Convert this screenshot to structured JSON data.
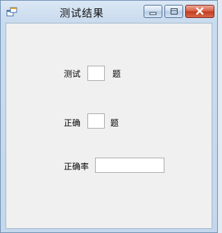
{
  "window": {
    "title": "测试结果",
    "icon": "app-window-icon",
    "controls": {
      "minimize_icon": "minimize-icon",
      "maximize_icon": "maximize-icon",
      "close_icon": "close-icon"
    }
  },
  "form": {
    "test_label": "测试",
    "test_value": "",
    "test_unit": "题",
    "correct_label": "正确",
    "correct_value": "",
    "correct_unit": "题",
    "rate_label": "正确率",
    "rate_value": ""
  },
  "colors": {
    "close_button": "#c8432a",
    "client_background": "#f0f0f0",
    "frame": "#c9dbee"
  }
}
